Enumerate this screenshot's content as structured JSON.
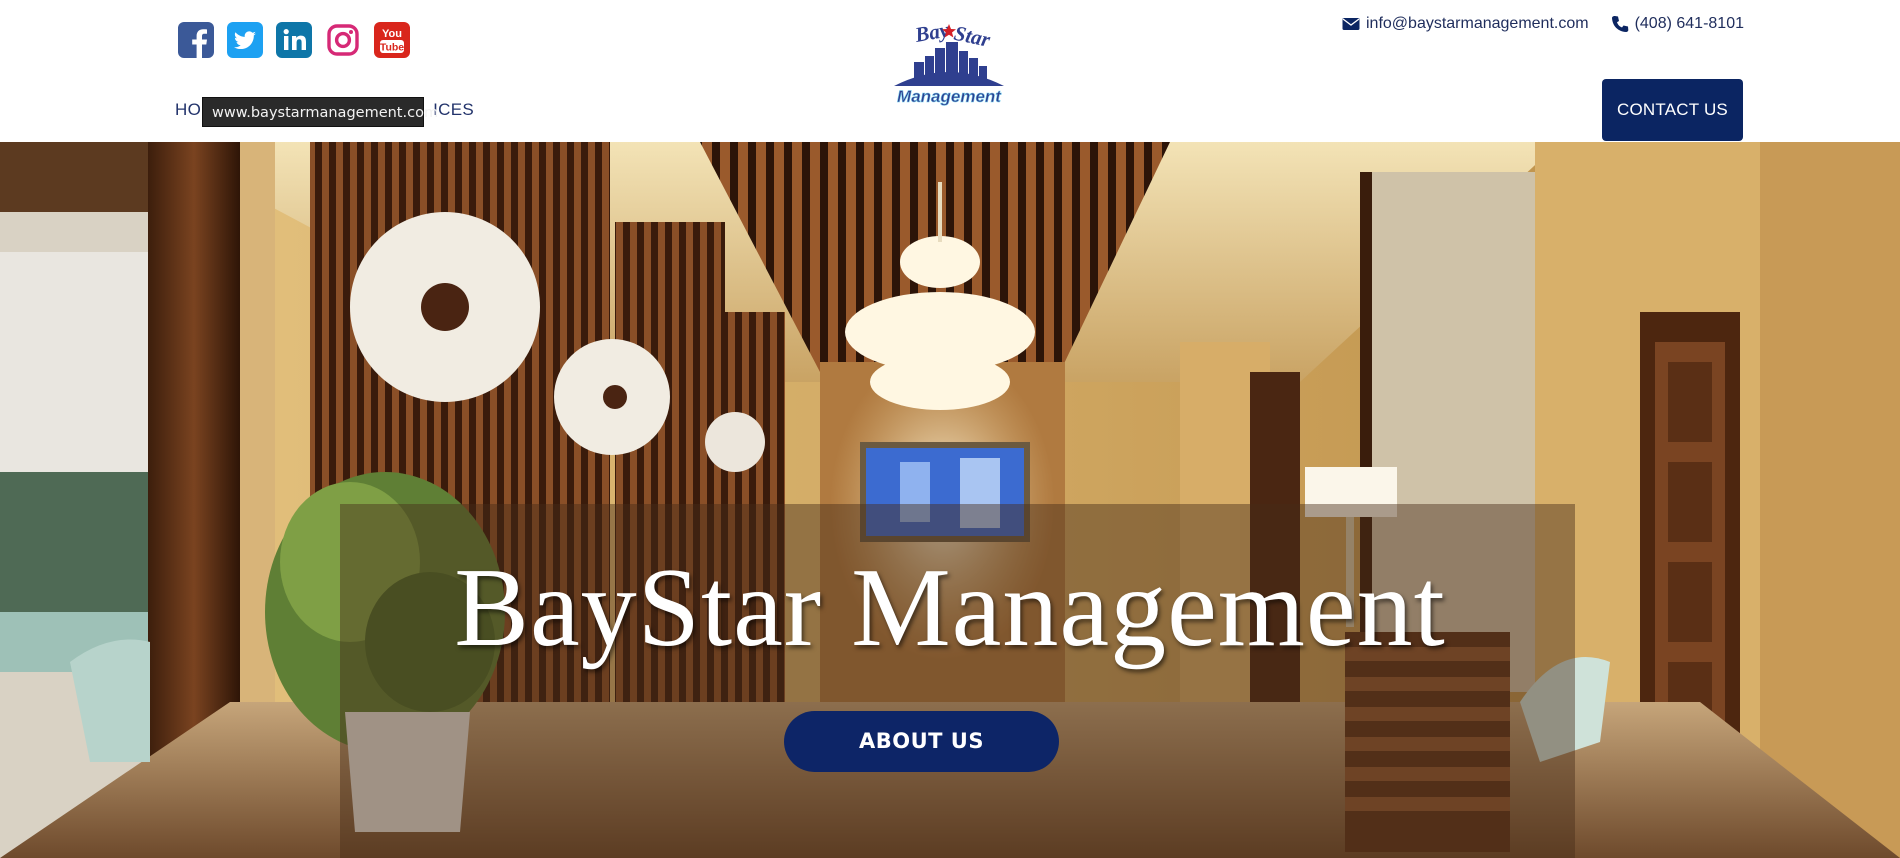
{
  "header": {
    "social": [
      {
        "name": "facebook",
        "icon": "facebook-icon",
        "color": "#3b5998"
      },
      {
        "name": "twitter",
        "icon": "twitter-icon",
        "color": "#1da1f2"
      },
      {
        "name": "linkedin",
        "icon": "linkedin-icon",
        "color": "#0e76a8"
      },
      {
        "name": "instagram",
        "icon": "instagram-icon",
        "color": "#d62976"
      },
      {
        "name": "youtube",
        "icon": "youtube-icon",
        "color": "#d9261c"
      }
    ],
    "email": "info@baystarmanagement.com",
    "phone": "(408) 641-8101",
    "logo": {
      "line1_left": "Bay",
      "line1_right": "Star",
      "line2": "Management"
    },
    "nav": {
      "item_left": "HO",
      "item_right": "ICES"
    },
    "tooltip": "www.baystarmanagement.com",
    "contact_button": "CONTACT US"
  },
  "hero": {
    "title": "BayStar Management",
    "about_button": "ABOUT US"
  },
  "colors": {
    "brand_navy": "#0b2562",
    "nav_text": "#22336b"
  }
}
